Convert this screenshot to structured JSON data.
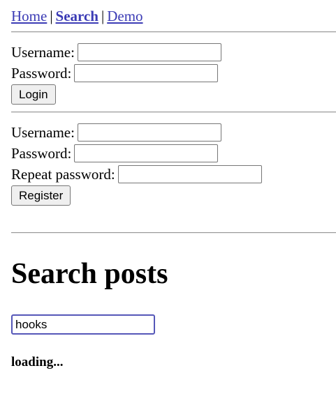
{
  "nav": {
    "home": "Home",
    "search": "Search",
    "demo": "Demo",
    "separator": "|"
  },
  "login": {
    "username_label": "Username:",
    "username_value": "",
    "password_label": "Password:",
    "password_value": "",
    "submit_label": "Login"
  },
  "register": {
    "username_label": "Username:",
    "username_value": "",
    "password_label": "Password:",
    "password_value": "",
    "repeat_label": "Repeat password:",
    "repeat_value": "",
    "submit_label": "Register"
  },
  "search": {
    "heading": "Search posts",
    "query": "hooks",
    "status": "loading..."
  }
}
